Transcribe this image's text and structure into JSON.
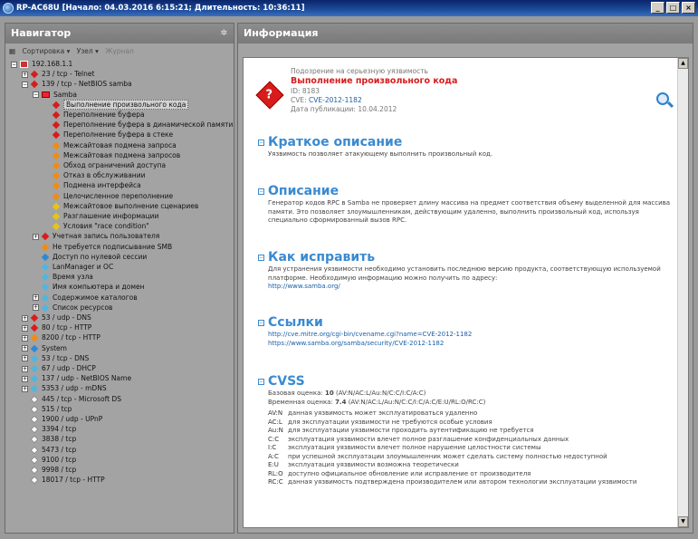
{
  "window": {
    "title": "RP-AC68U [Начало: 04.03.2016 6:15:21; Длительность: 10:36:11]",
    "min": "_",
    "max": "□",
    "close": "×"
  },
  "navigator": {
    "title": "Навигатор",
    "toolbar": {
      "sort": "Сортировка ▾",
      "node": "Узел ▾",
      "journal": "Журнал"
    },
    "tree": [
      {
        "label": "192.168.1.1",
        "indent": 0,
        "icon": "hostic",
        "exp": "−"
      },
      {
        "label": "23 / tcp - Telnet",
        "indent": 1,
        "icon": "red",
        "exp": "+"
      },
      {
        "label": "139 / tcp - NetBIOS samba",
        "indent": 1,
        "icon": "red",
        "exp": "−"
      },
      {
        "label": "Samba",
        "indent": 2,
        "icon": "fold",
        "exp": "−"
      },
      {
        "label": "Выполнение произвольного кода",
        "indent": 3,
        "icon": "red",
        "sel": true
      },
      {
        "label": "Переполнение буфера",
        "indent": 3,
        "icon": "red"
      },
      {
        "label": "Переполнение буфера в динамической памяти",
        "indent": 3,
        "icon": "red"
      },
      {
        "label": "Переполнение буфера в стеке",
        "indent": 3,
        "icon": "red"
      },
      {
        "label": "Межсайтовая подмена запроса",
        "indent": 3,
        "icon": "org"
      },
      {
        "label": "Межсайтовая подмена запросов",
        "indent": 3,
        "icon": "org"
      },
      {
        "label": "Обход ограничений доступа",
        "indent": 3,
        "icon": "org"
      },
      {
        "label": "Отказ в обслуживании",
        "indent": 3,
        "icon": "org"
      },
      {
        "label": "Подмена интерфейса",
        "indent": 3,
        "icon": "org"
      },
      {
        "label": "Целочисленное переполнение",
        "indent": 3,
        "icon": "org"
      },
      {
        "label": "Межсайтовое выполнение сценариев",
        "indent": 3,
        "icon": "ylw"
      },
      {
        "label": "Разглашение информации",
        "indent": 3,
        "icon": "ylw"
      },
      {
        "label": "Условия \"race condition\"",
        "indent": 3,
        "icon": "ylw"
      },
      {
        "label": "Учетная запись пользователя",
        "indent": 2,
        "icon": "red",
        "exp": "+"
      },
      {
        "label": "Не требуется подписывание SMB",
        "indent": 2,
        "icon": "org"
      },
      {
        "label": "Доступ по нулевой сессии",
        "indent": 2,
        "icon": "blu"
      },
      {
        "label": "LanManager и ОС",
        "indent": 2,
        "icon": "cyn"
      },
      {
        "label": "Время узла",
        "indent": 2,
        "icon": "cyn"
      },
      {
        "label": "Имя компьютера и домен",
        "indent": 2,
        "icon": "cyn"
      },
      {
        "label": "Содержимое каталогов",
        "indent": 2,
        "icon": "cyn",
        "exp": "+"
      },
      {
        "label": "Список ресурсов",
        "indent": 2,
        "icon": "cyn",
        "exp": "+"
      },
      {
        "label": "53 / udp - DNS",
        "indent": 1,
        "icon": "red",
        "exp": "+"
      },
      {
        "label": "80 / tcp - HTTP",
        "indent": 1,
        "icon": "red",
        "exp": "+"
      },
      {
        "label": "8200 / tcp - HTTP",
        "indent": 1,
        "icon": "org",
        "exp": "+"
      },
      {
        "label": "System",
        "indent": 1,
        "icon": "blu",
        "exp": "+"
      },
      {
        "label": "53 / tcp - DNS",
        "indent": 1,
        "icon": "cyn",
        "exp": "+"
      },
      {
        "label": "67 / udp - DHCP",
        "indent": 1,
        "icon": "cyn",
        "exp": "+"
      },
      {
        "label": "137 / udp - NetBIOS Name",
        "indent": 1,
        "icon": "cyn",
        "exp": "+"
      },
      {
        "label": "5353 / udp - mDNS",
        "indent": 1,
        "icon": "cyn",
        "exp": "+"
      },
      {
        "label": "445 / tcp - Microsoft DS",
        "indent": 1,
        "icon": "wht"
      },
      {
        "label": "515 / tcp",
        "indent": 1,
        "icon": "wht"
      },
      {
        "label": "1900 / udp - UPnP",
        "indent": 1,
        "icon": "wht"
      },
      {
        "label": "3394 / tcp",
        "indent": 1,
        "icon": "wht"
      },
      {
        "label": "3838 / tcp",
        "indent": 1,
        "icon": "wht"
      },
      {
        "label": "5473 / tcp",
        "indent": 1,
        "icon": "wht"
      },
      {
        "label": "9100 / tcp",
        "indent": 1,
        "icon": "wht"
      },
      {
        "label": "9998 / tcp",
        "indent": 1,
        "icon": "wht"
      },
      {
        "label": "18017 / tcp - HTTP",
        "indent": 1,
        "icon": "wht"
      }
    ]
  },
  "info": {
    "title": "Информация",
    "vuln": {
      "suspicion": "Подозрение на серьезную уязвимость",
      "name": "Выполнение произвольного кода",
      "id": "ID: 8183",
      "cve_label": "CVE:",
      "cve": "CVE-2012-1182",
      "published": "Дата публикации: 10.04.2012"
    },
    "summary": {
      "title": "Краткое описание",
      "text": "Уязвимость позволяет атакующему выполнить произвольный код."
    },
    "description": {
      "title": "Описание",
      "text": "Генератор кодов RPC в Samba не проверяет длину массива на предмет соответствия объему выделенной для массива памяти. Это позволяет злоумышленникам, действующим удаленно, выполнить произвольный код, используя специально сформированный вызов RPC."
    },
    "fix": {
      "title": "Как исправить",
      "text": "Для устранения уязвимости необходимо установить последнюю версию продукта, соответствующую используемой платформе. Необходимую информацию можно получить по адресу:",
      "link": "http://www.samba.org/"
    },
    "refs": {
      "title": "Ссылки",
      "links": [
        "http://cve.mitre.org/cgi-bin/cvename.cgi?name=CVE-2012-1182",
        "https://www.samba.org/samba/security/CVE-2012-1182"
      ]
    },
    "cvss": {
      "title": "CVSS",
      "base_label": "Базовая оценка:",
      "base_score": "10",
      "base_vector": "(AV:N/AC:L/Au:N/C:C/I:C/A:C)",
      "temp_label": "Временная оценка:",
      "temp_score": "7.4",
      "temp_vector": "(AV:N/AC:L/Au:N/C:C/I:C/A:C/E:U/RL:O/RC:C)",
      "rows": [
        {
          "k": "AV:N",
          "v": "данная уязвимость может эксплуатироваться удаленно"
        },
        {
          "k": "AC:L",
          "v": "для эксплуатации уязвимости не требуются особые условия"
        },
        {
          "k": "Au:N",
          "v": "для эксплуатации уязвимости проходить аутентификацию не требуется"
        },
        {
          "k": "C:C",
          "v": "эксплуатация уязвимости влечет полное разглашение конфиденциальных данных"
        },
        {
          "k": "I:C",
          "v": "эксплуатация уязвимости влечет полное нарушение целостности системы"
        },
        {
          "k": "A:C",
          "v": "при успешной эксплуатации злоумышленник может сделать систему полностью недоступной"
        },
        {
          "k": "E:U",
          "v": "эксплуатация уязвимости возможна теоретически"
        },
        {
          "k": "RL:O",
          "v": "доступно официальное обновление или исправление от производителя"
        },
        {
          "k": "RC:C",
          "v": "данная уязвимость подтверждена производителем или автором технологии эксплуатации уязвимости"
        }
      ]
    }
  }
}
